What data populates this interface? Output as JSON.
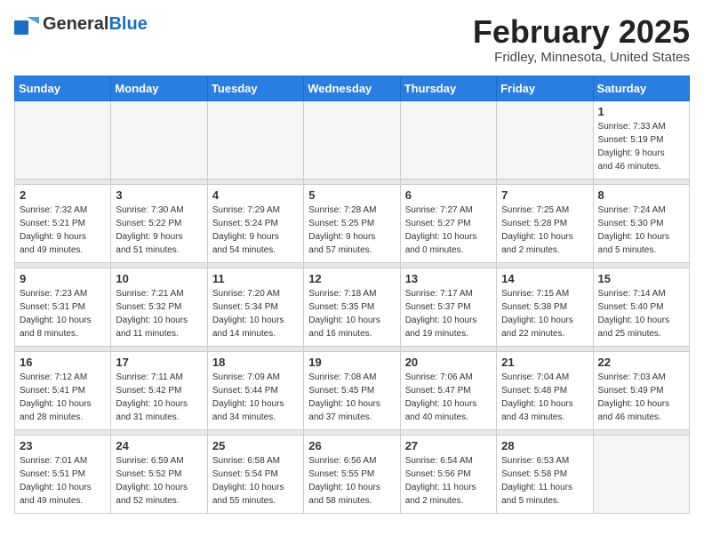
{
  "header": {
    "logo_general": "General",
    "logo_blue": "Blue",
    "month_title": "February 2025",
    "location": "Fridley, Minnesota, United States"
  },
  "days_of_week": [
    "Sunday",
    "Monday",
    "Tuesday",
    "Wednesday",
    "Thursday",
    "Friday",
    "Saturday"
  ],
  "weeks": [
    [
      {
        "day": "",
        "info": ""
      },
      {
        "day": "",
        "info": ""
      },
      {
        "day": "",
        "info": ""
      },
      {
        "day": "",
        "info": ""
      },
      {
        "day": "",
        "info": ""
      },
      {
        "day": "",
        "info": ""
      },
      {
        "day": "1",
        "info": "Sunrise: 7:33 AM\nSunset: 5:19 PM\nDaylight: 9 hours\nand 46 minutes."
      }
    ],
    [
      {
        "day": "2",
        "info": "Sunrise: 7:32 AM\nSunset: 5:21 PM\nDaylight: 9 hours\nand 49 minutes."
      },
      {
        "day": "3",
        "info": "Sunrise: 7:30 AM\nSunset: 5:22 PM\nDaylight: 9 hours\nand 51 minutes."
      },
      {
        "day": "4",
        "info": "Sunrise: 7:29 AM\nSunset: 5:24 PM\nDaylight: 9 hours\nand 54 minutes."
      },
      {
        "day": "5",
        "info": "Sunrise: 7:28 AM\nSunset: 5:25 PM\nDaylight: 9 hours\nand 57 minutes."
      },
      {
        "day": "6",
        "info": "Sunrise: 7:27 AM\nSunset: 5:27 PM\nDaylight: 10 hours\nand 0 minutes."
      },
      {
        "day": "7",
        "info": "Sunrise: 7:25 AM\nSunset: 5:28 PM\nDaylight: 10 hours\nand 2 minutes."
      },
      {
        "day": "8",
        "info": "Sunrise: 7:24 AM\nSunset: 5:30 PM\nDaylight: 10 hours\nand 5 minutes."
      }
    ],
    [
      {
        "day": "9",
        "info": "Sunrise: 7:23 AM\nSunset: 5:31 PM\nDaylight: 10 hours\nand 8 minutes."
      },
      {
        "day": "10",
        "info": "Sunrise: 7:21 AM\nSunset: 5:32 PM\nDaylight: 10 hours\nand 11 minutes."
      },
      {
        "day": "11",
        "info": "Sunrise: 7:20 AM\nSunset: 5:34 PM\nDaylight: 10 hours\nand 14 minutes."
      },
      {
        "day": "12",
        "info": "Sunrise: 7:18 AM\nSunset: 5:35 PM\nDaylight: 10 hours\nand 16 minutes."
      },
      {
        "day": "13",
        "info": "Sunrise: 7:17 AM\nSunset: 5:37 PM\nDaylight: 10 hours\nand 19 minutes."
      },
      {
        "day": "14",
        "info": "Sunrise: 7:15 AM\nSunset: 5:38 PM\nDaylight: 10 hours\nand 22 minutes."
      },
      {
        "day": "15",
        "info": "Sunrise: 7:14 AM\nSunset: 5:40 PM\nDaylight: 10 hours\nand 25 minutes."
      }
    ],
    [
      {
        "day": "16",
        "info": "Sunrise: 7:12 AM\nSunset: 5:41 PM\nDaylight: 10 hours\nand 28 minutes."
      },
      {
        "day": "17",
        "info": "Sunrise: 7:11 AM\nSunset: 5:42 PM\nDaylight: 10 hours\nand 31 minutes."
      },
      {
        "day": "18",
        "info": "Sunrise: 7:09 AM\nSunset: 5:44 PM\nDaylight: 10 hours\nand 34 minutes."
      },
      {
        "day": "19",
        "info": "Sunrise: 7:08 AM\nSunset: 5:45 PM\nDaylight: 10 hours\nand 37 minutes."
      },
      {
        "day": "20",
        "info": "Sunrise: 7:06 AM\nSunset: 5:47 PM\nDaylight: 10 hours\nand 40 minutes."
      },
      {
        "day": "21",
        "info": "Sunrise: 7:04 AM\nSunset: 5:48 PM\nDaylight: 10 hours\nand 43 minutes."
      },
      {
        "day": "22",
        "info": "Sunrise: 7:03 AM\nSunset: 5:49 PM\nDaylight: 10 hours\nand 46 minutes."
      }
    ],
    [
      {
        "day": "23",
        "info": "Sunrise: 7:01 AM\nSunset: 5:51 PM\nDaylight: 10 hours\nand 49 minutes."
      },
      {
        "day": "24",
        "info": "Sunrise: 6:59 AM\nSunset: 5:52 PM\nDaylight: 10 hours\nand 52 minutes."
      },
      {
        "day": "25",
        "info": "Sunrise: 6:58 AM\nSunset: 5:54 PM\nDaylight: 10 hours\nand 55 minutes."
      },
      {
        "day": "26",
        "info": "Sunrise: 6:56 AM\nSunset: 5:55 PM\nDaylight: 10 hours\nand 58 minutes."
      },
      {
        "day": "27",
        "info": "Sunrise: 6:54 AM\nSunset: 5:56 PM\nDaylight: 11 hours\nand 2 minutes."
      },
      {
        "day": "28",
        "info": "Sunrise: 6:53 AM\nSunset: 5:58 PM\nDaylight: 11 hours\nand 5 minutes."
      },
      {
        "day": "",
        "info": ""
      }
    ]
  ]
}
